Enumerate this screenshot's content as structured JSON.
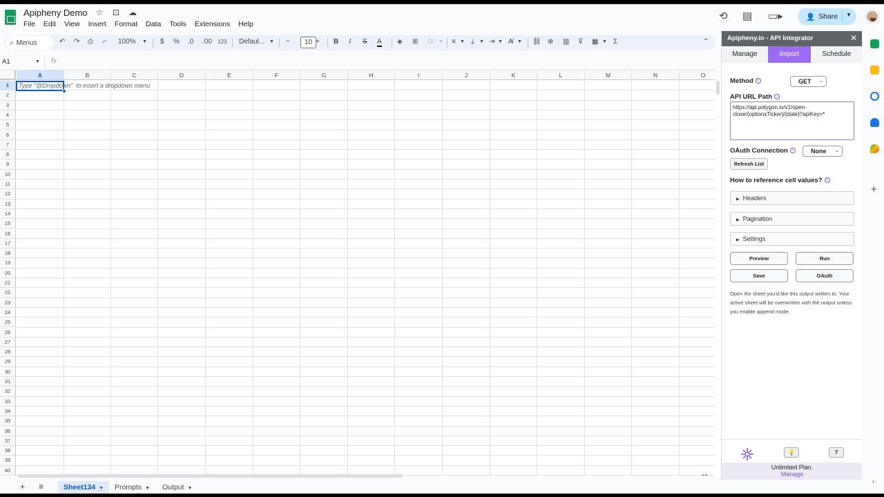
{
  "doc": {
    "title": "Apipheny Demo"
  },
  "menu": [
    "File",
    "Edit",
    "View",
    "Insert",
    "Format",
    "Data",
    "Tools",
    "Extensions",
    "Help"
  ],
  "share_label": "Share",
  "toolbar": {
    "search_label": "Menus",
    "zoom": "100%",
    "currency": "$",
    "percent": "%",
    "dec_decrease": ".0",
    "dec_increase": ".00",
    "number_format": "123",
    "font": "Defaul...",
    "font_size": "10",
    "bold": "B",
    "italic": "I"
  },
  "formula": {
    "cell_ref": "A1",
    "fx": "fx"
  },
  "grid": {
    "columns": [
      "A",
      "B",
      "C",
      "D",
      "E",
      "F",
      "G",
      "H",
      "I",
      "J",
      "K",
      "L",
      "M",
      "N",
      "O"
    ],
    "rows": [
      "1",
      "2",
      "3",
      "4",
      "5",
      "6",
      "7",
      "8",
      "9",
      "10",
      "11",
      "12",
      "13",
      "14",
      "15",
      "16",
      "17",
      "18",
      "19",
      "20",
      "21",
      "22",
      "23",
      "24",
      "25",
      "26",
      "27",
      "28",
      "29",
      "30",
      "31",
      "32",
      "33",
      "34",
      "35",
      "36",
      "37",
      "38",
      "39",
      "40"
    ],
    "selected_cell": "A1",
    "hint": "Type \"@Dropdown\"  to insert a dropdown menu"
  },
  "sheets": [
    {
      "name": "Sheet134",
      "active": true
    },
    {
      "name": "Prompts",
      "active": false
    },
    {
      "name": "Output",
      "active": false
    }
  ],
  "panel": {
    "title": "Apipheny.io - API Integrator",
    "tabs": [
      {
        "label": "Manage",
        "active": false
      },
      {
        "label": "Import",
        "active": true
      },
      {
        "label": "Schedule",
        "active": false
      }
    ],
    "method_label": "Method",
    "method_value": "GET",
    "url_label": "API URL Path",
    "url_value": "https://api.polygon.io/v1/open-close/{optionsTicker}/{date}?apiKey=*",
    "oauth_label": "OAuth Connection",
    "oauth_value": "None",
    "refresh_label": "Refresh List",
    "reference_label": "How to reference cell values?",
    "accordions": [
      "Headers",
      "Pagination",
      "Settings"
    ],
    "buttons": {
      "preview": "Preview",
      "run": "Run",
      "save": "Save",
      "oauth": "OAuth"
    },
    "note": "Open the sheet you'd like this output written to. Your active sheet will be overwritten with the output unless you enable append mode.",
    "help_label": "?",
    "plan_text": "Unlimited Plan.",
    "plan_link": "Manage"
  },
  "colors": {
    "accent": "#9b6bf5",
    "sheets_green": "#0f9d58",
    "selection": "#0b57d0",
    "share_bg": "#c2e7ff"
  }
}
